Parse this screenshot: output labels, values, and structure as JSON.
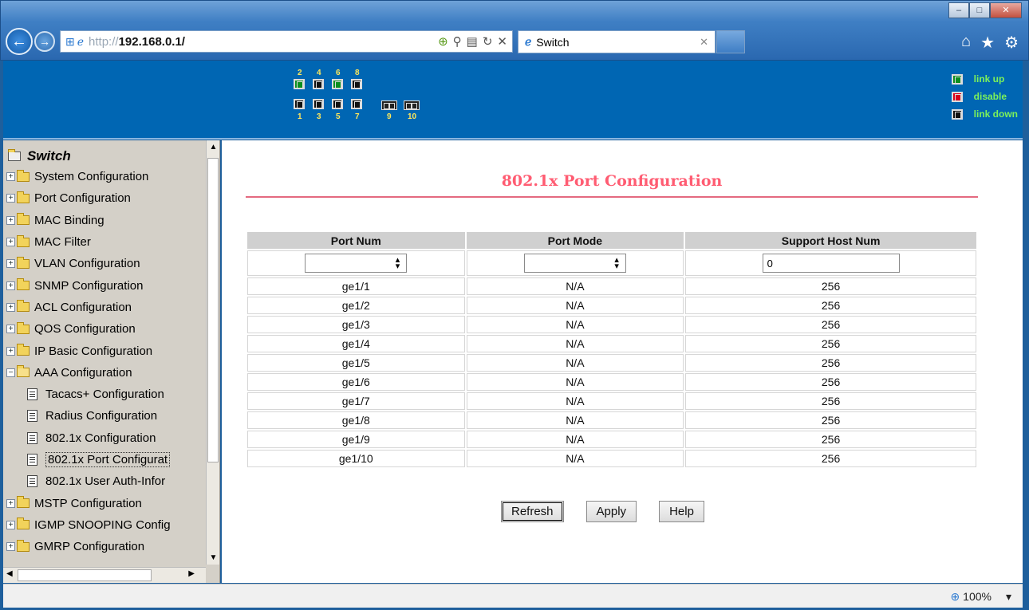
{
  "browser": {
    "url_prefix": "http://",
    "url_host": "192.168.0.1/",
    "tab_title": "Switch",
    "win_minimize": "–",
    "win_maximize": "□",
    "win_close": "✕"
  },
  "banner": {
    "top_port_numbers": [
      "2",
      "4",
      "6",
      "8"
    ],
    "bottom_port_numbers": [
      "1",
      "3",
      "5",
      "7",
      "9",
      "10"
    ],
    "port_states": {
      "1": "down",
      "2": "up",
      "3": "down",
      "4": "down",
      "5": "down",
      "6": "up",
      "7": "down",
      "8": "down"
    },
    "legend": {
      "up": "link up",
      "disable": "disable",
      "down": "link down"
    },
    "colors": {
      "up": "#0b8f1f",
      "disable": "#d6001c",
      "down": "#111111",
      "legend_text": "#7cf25a",
      "port_num": "#ffe95a"
    }
  },
  "sidebar": {
    "root": "Switch",
    "items": [
      {
        "label": "System Configuration",
        "type": "folder",
        "expand": "+"
      },
      {
        "label": "Port Configuration",
        "type": "folder",
        "expand": "+"
      },
      {
        "label": "MAC Binding",
        "type": "folder",
        "expand": "+"
      },
      {
        "label": "MAC Filter",
        "type": "folder",
        "expand": "+"
      },
      {
        "label": "VLAN Configuration",
        "type": "folder",
        "expand": "+"
      },
      {
        "label": "SNMP Configuration",
        "type": "folder",
        "expand": "+"
      },
      {
        "label": "ACL Configuration",
        "type": "folder",
        "expand": "+"
      },
      {
        "label": "QOS Configuration",
        "type": "folder",
        "expand": "+"
      },
      {
        "label": "IP Basic Configuration",
        "type": "folder",
        "expand": "+"
      },
      {
        "label": "AAA Configuration",
        "type": "folder-open",
        "expand": "−"
      },
      {
        "label": "Tacacs+ Configuration",
        "type": "doc"
      },
      {
        "label": "Radius Configuration",
        "type": "doc"
      },
      {
        "label": "802.1x Configuration",
        "type": "doc"
      },
      {
        "label": "802.1x Port Configurat",
        "type": "doc",
        "selected": true
      },
      {
        "label": "802.1x User Auth-Infor",
        "type": "doc"
      },
      {
        "label": "MSTP Configuration",
        "type": "folder",
        "expand": "+"
      },
      {
        "label": "IGMP SNOOPING Config",
        "type": "folder",
        "expand": "+"
      },
      {
        "label": "GMRP Configuration",
        "type": "folder",
        "expand": "+"
      }
    ]
  },
  "main": {
    "title": "802.1x Port Configuration",
    "columns": [
      "Port Num",
      "Port Mode",
      "Support Host Num"
    ],
    "filter": {
      "port_num": "",
      "port_mode": "",
      "host_num": "0"
    },
    "rows": [
      [
        "ge1/1",
        "N/A",
        "256"
      ],
      [
        "ge1/2",
        "N/A",
        "256"
      ],
      [
        "ge1/3",
        "N/A",
        "256"
      ],
      [
        "ge1/4",
        "N/A",
        "256"
      ],
      [
        "ge1/5",
        "N/A",
        "256"
      ],
      [
        "ge1/6",
        "N/A",
        "256"
      ],
      [
        "ge1/7",
        "N/A",
        "256"
      ],
      [
        "ge1/8",
        "N/A",
        "256"
      ],
      [
        "ge1/9",
        "N/A",
        "256"
      ],
      [
        "ge1/10",
        "N/A",
        "256"
      ]
    ],
    "buttons": {
      "refresh": "Refresh",
      "apply": "Apply",
      "help": "Help"
    },
    "accent": "#ff5c72"
  },
  "statusbar": {
    "zoom": "100%"
  }
}
